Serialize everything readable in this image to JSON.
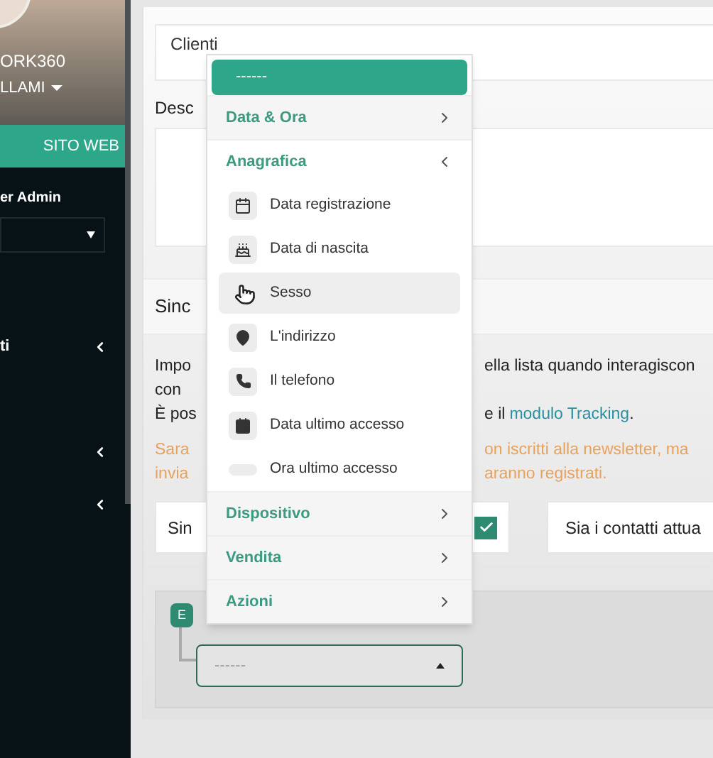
{
  "sidebar": {
    "profile_name": "ORK360",
    "profile_menu": "LLAMI",
    "website_button": "SITO WEB",
    "role_label": "er Admin",
    "nav_items": [
      {
        "label": "ti",
        "expanded": false
      },
      {
        "expanded": false
      },
      {
        "expanded": false
      }
    ]
  },
  "form": {
    "list_field": {
      "value": "Clienti"
    },
    "description_label": "Desc",
    "sync_section": {
      "title": "Sinc",
      "lines": [
        {
          "kind": "normal",
          "left": "Impo",
          "right": "ella lista quando interagiscon"
        },
        {
          "kind": "normal",
          "left": "con"
        },
        {
          "kind": "normal",
          "left": "È pos",
          "right": "e il",
          "link": "modulo Tracking",
          "after": "."
        },
        {
          "kind": "warning",
          "left": "Sara",
          "right": "on iscritti alla newsletter, ma"
        },
        {
          "kind": "warning",
          "left": "invia",
          "right": "aranno registrati."
        }
      ],
      "option_left": {
        "label": "Sin",
        "checked": true
      },
      "option_right": {
        "label": "Sia i contatti attua"
      }
    },
    "condition": {
      "badge": "E",
      "select": {
        "value": "------",
        "open": true
      }
    }
  },
  "dropdown": {
    "header": "------",
    "groups": [
      {
        "label": "Data & Ora",
        "expanded": false
      },
      {
        "label": "Anagrafica",
        "expanded": true,
        "items": [
          {
            "label": "Data registrazione",
            "kind": "calendar",
            "hovered": false
          },
          {
            "label": "Data di nascita",
            "kind": "cake",
            "hovered": false
          },
          {
            "label": "Sesso",
            "kind": "hidden",
            "hovered": true
          },
          {
            "label": "L'indirizzo",
            "kind": "pin",
            "hovered": false
          },
          {
            "label": "Il telefono",
            "kind": "phone",
            "hovered": false
          },
          {
            "label": "Data ultimo accesso",
            "kind": "event",
            "hovered": false
          },
          {
            "label": "Ora ultimo accesso",
            "kind": "blank",
            "hovered": false
          }
        ]
      },
      {
        "label": "Dispositivo",
        "expanded": false
      },
      {
        "label": "Vendita",
        "expanded": false
      },
      {
        "label": "Azioni",
        "expanded": false
      }
    ]
  }
}
